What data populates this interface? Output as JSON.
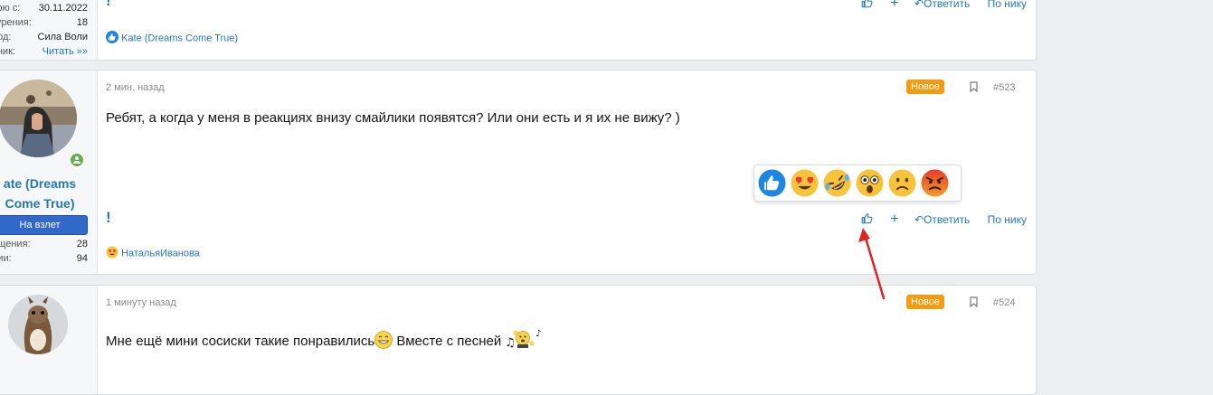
{
  "post_522": {
    "stats": [
      {
        "label": "урю с:",
        "value": "30.11.2022"
      },
      {
        "label": "курения:",
        "value": "18"
      },
      {
        "label": "род:",
        "value": "Сила Воли"
      },
      {
        "label": "вник:",
        "value": "Читать »»"
      }
    ],
    "actions": {
      "plus": "+",
      "reply": "Ответить",
      "nick": "По нику"
    },
    "reactor": "Kate (Dreams Come True)"
  },
  "post_523": {
    "author_name_line1": "ate (Dreams",
    "author_name_line2": "Come True)",
    "role": "На взлет",
    "stats": [
      {
        "label": "бщения:",
        "value": "28"
      },
      {
        "label": "ции:",
        "value": "94"
      }
    ],
    "time": "2 мин. назад",
    "badge": "Новое",
    "number": "#523",
    "message": "Ребят, а когда у меня в реакциях внизу смайлики появятся? Или они есть и я их не вижу? )",
    "warn": "!",
    "actions": {
      "plus": "+",
      "reply": "Ответить",
      "nick": "По нику"
    },
    "reactor": "НатальяИванова"
  },
  "post_524": {
    "time": "1 минуту назад",
    "badge": "Новое",
    "number": "#524",
    "message_part1": "Мне ещё мини сосиски такие понравились",
    "message_part2": " Вместе с песней "
  },
  "reactions": [
    "like-icon",
    "heart-eyes-icon",
    "rofl-icon",
    "astonished-icon",
    "sad-icon",
    "angry-icon"
  ],
  "colors": {
    "accent": "#2577b1",
    "badge": "#f39c12",
    "role": "#3169ca",
    "arrow": "#e02424"
  }
}
